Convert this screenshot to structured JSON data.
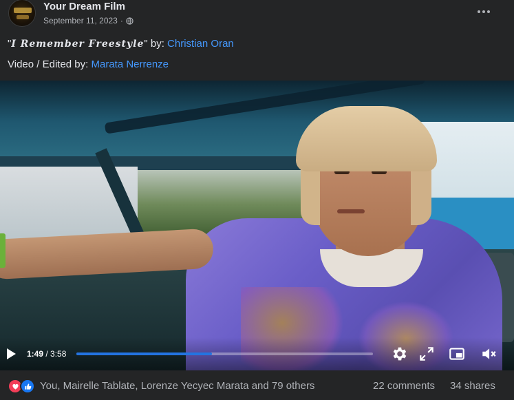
{
  "post": {
    "page_name": "Your Dream Film",
    "date": "September 11, 2023",
    "date_separator": "·",
    "privacy_icon": "globe-icon",
    "more_icon": "more-dots-icon"
  },
  "caption": {
    "open_quote": "\"",
    "song_title": "I Remember Freestyle",
    "close_quote": "\" by: ",
    "artist": "Christian Oran",
    "credit_prefix": "Video / Edited by: ",
    "editor": "Marata Nerrenze"
  },
  "video": {
    "current_time": "1:49",
    "time_separator": " / ",
    "duration": "3:58",
    "progress_fraction": 0.458,
    "icons": [
      "play-icon",
      "settings-gear-icon",
      "fullscreen-expand-icon",
      "picture-in-picture-icon",
      "volume-muted-icon"
    ]
  },
  "engagement": {
    "reaction_icons": [
      "love-reaction-icon",
      "like-reaction-icon"
    ],
    "reactions_text": "You, Mairelle Tablate, Lorenze Yecyec Marata and 79 others",
    "comments": "22 comments",
    "shares": "34 shares"
  },
  "colors": {
    "background": "#242526",
    "text_primary": "#e4e6eb",
    "text_secondary": "#b0b3b8",
    "link": "#4599ff",
    "progress": "#2374e1",
    "love": "#f33e58",
    "like": "#1877f2"
  }
}
